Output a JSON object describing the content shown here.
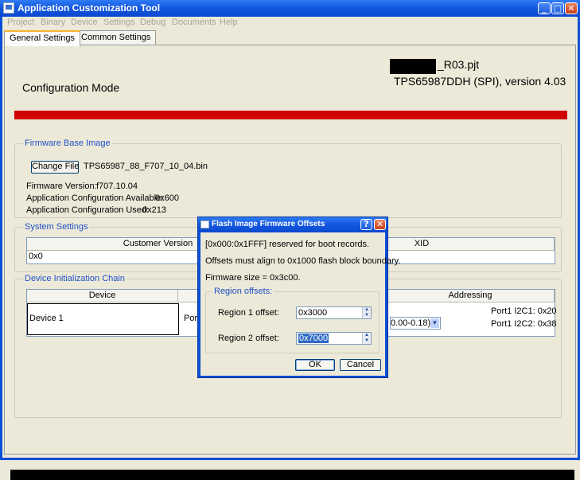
{
  "window": {
    "title": "Application Customization Tool",
    "controls": {
      "minimize": "_",
      "maximize": "□",
      "close": "✕"
    }
  },
  "menubar": [
    "Project",
    "Binary",
    "Device",
    "Settings",
    "Debug",
    "Documents",
    "Help"
  ],
  "tabs": [
    {
      "label": "General Settings",
      "active": true
    },
    {
      "label": "Common Settings",
      "active": false
    }
  ],
  "header": {
    "mode": "Configuration Mode",
    "project_file_suffix": "_R03.pjt",
    "device_version": "TPS65987DDH (SPI), version 4.03"
  },
  "firmware": {
    "legend": "Firmware Base Image",
    "change_file_label": "Change File",
    "filename": "TPS65987_88_F707_10_04.bin",
    "version_label": "Firmware Version:",
    "version_value": "f707.10.04",
    "app_cfg_avail_label": "Application Configuration Available:",
    "app_cfg_avail_value": "0x600",
    "app_cfg_used_label": "Application Configuration Used:",
    "app_cfg_used_value": "0x213"
  },
  "system_settings": {
    "legend": "System Settings",
    "columns": [
      "Customer Version",
      "XID"
    ],
    "row": [
      "0x0",
      ""
    ]
  },
  "device_chain": {
    "legend": "Device Initialization Chain",
    "columns": [
      "Device",
      "Addressing"
    ],
    "device": "Device 1",
    "port_partial": "Port",
    "addressing_select": "0.00-0.18)",
    "port1_i2c1": "Port1 I2C1: 0x20",
    "port1_i2c2": "Port1 I2C2: 0x38"
  },
  "dialog": {
    "title": "Flash Image Firmware Offsets",
    "help_btn": "?",
    "close_btn": "✕",
    "line1": "[0x000:0x1FFF] reserved for boot records.",
    "line2": "Offsets must align to 0x1000 flash block boundary.",
    "line3": "Firmware size = 0x3c00.",
    "region_legend": "Region offsets:",
    "region1_label": "Region 1 offset:",
    "region1_value": "0x3000",
    "region2_label": "Region 2 offset:",
    "region2_value": "0x7000",
    "ok_label": "OK",
    "cancel_label": "Cancel"
  }
}
